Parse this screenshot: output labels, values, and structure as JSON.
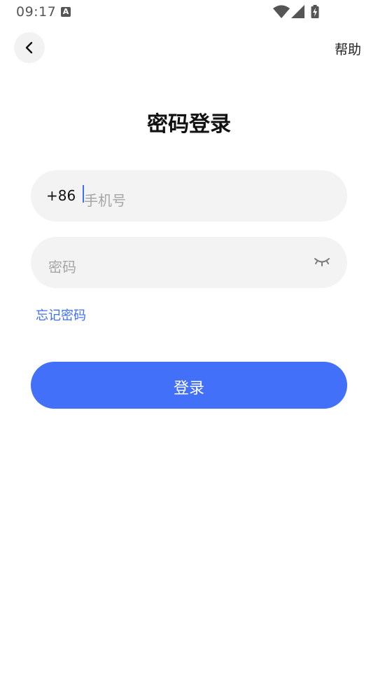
{
  "status_bar": {
    "time": "09:17",
    "notification_icon": "a-icon",
    "icons": [
      "wifi-icon",
      "cellular-signal-icon",
      "battery-charging-icon"
    ]
  },
  "nav": {
    "back_icon": "chevron-left-icon",
    "help_label": "帮助"
  },
  "page": {
    "title": "密码登录"
  },
  "phone_field": {
    "country_code": "+86",
    "value": "",
    "placeholder": "手机号"
  },
  "password_field": {
    "value": "",
    "placeholder": "密码",
    "visibility_icon": "eye-closed-icon"
  },
  "forgot_password_label": "忘记密码",
  "login_button_label": "登录",
  "colors": {
    "accent": "#4270f9",
    "field_background": "#f3f3f3",
    "placeholder": "#a6a6a6"
  }
}
